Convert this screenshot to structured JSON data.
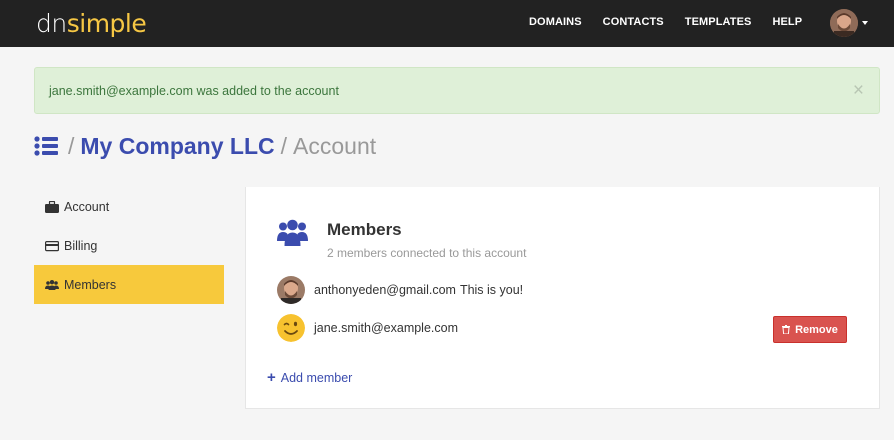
{
  "brand": {
    "logo_prefix": "dn",
    "logo_suffix": "simple"
  },
  "nav": {
    "links": [
      "DOMAINS",
      "CONTACTS",
      "TEMPLATES",
      "HELP"
    ],
    "user_menu_icon": "chevron-down-icon"
  },
  "alert": {
    "message": "jane.smith@example.com was added to the account",
    "close_symbol": "×",
    "type": "success"
  },
  "breadcrumb": {
    "separator": "/",
    "company": "My Company LLC",
    "current": "Account"
  },
  "sidebar": {
    "items": [
      {
        "label": "Account",
        "icon": "briefcase-icon",
        "active": false
      },
      {
        "label": "Billing",
        "icon": "credit-card-icon",
        "active": false
      },
      {
        "label": "Members",
        "icon": "users-icon",
        "active": true
      }
    ]
  },
  "members_panel": {
    "title": "Members",
    "subtitle": "2 members connected to this account",
    "members": [
      {
        "email": "anthonyeden@gmail.com",
        "note": "This is you!",
        "avatar": "user-photo"
      },
      {
        "email": "jane.smith@example.com",
        "note": "",
        "avatar": "winking-emoji"
      }
    ],
    "remove_label": "Remove",
    "add_label": "Add member",
    "add_symbol": "+"
  },
  "colors": {
    "navbar": "#222222",
    "brand_yellow": "#f6c744",
    "link_blue": "#3b4cae",
    "active_yellow": "#f7c93c",
    "danger": "#d9534f",
    "alert_bg": "#dff0d8",
    "alert_text": "#3c763d"
  }
}
